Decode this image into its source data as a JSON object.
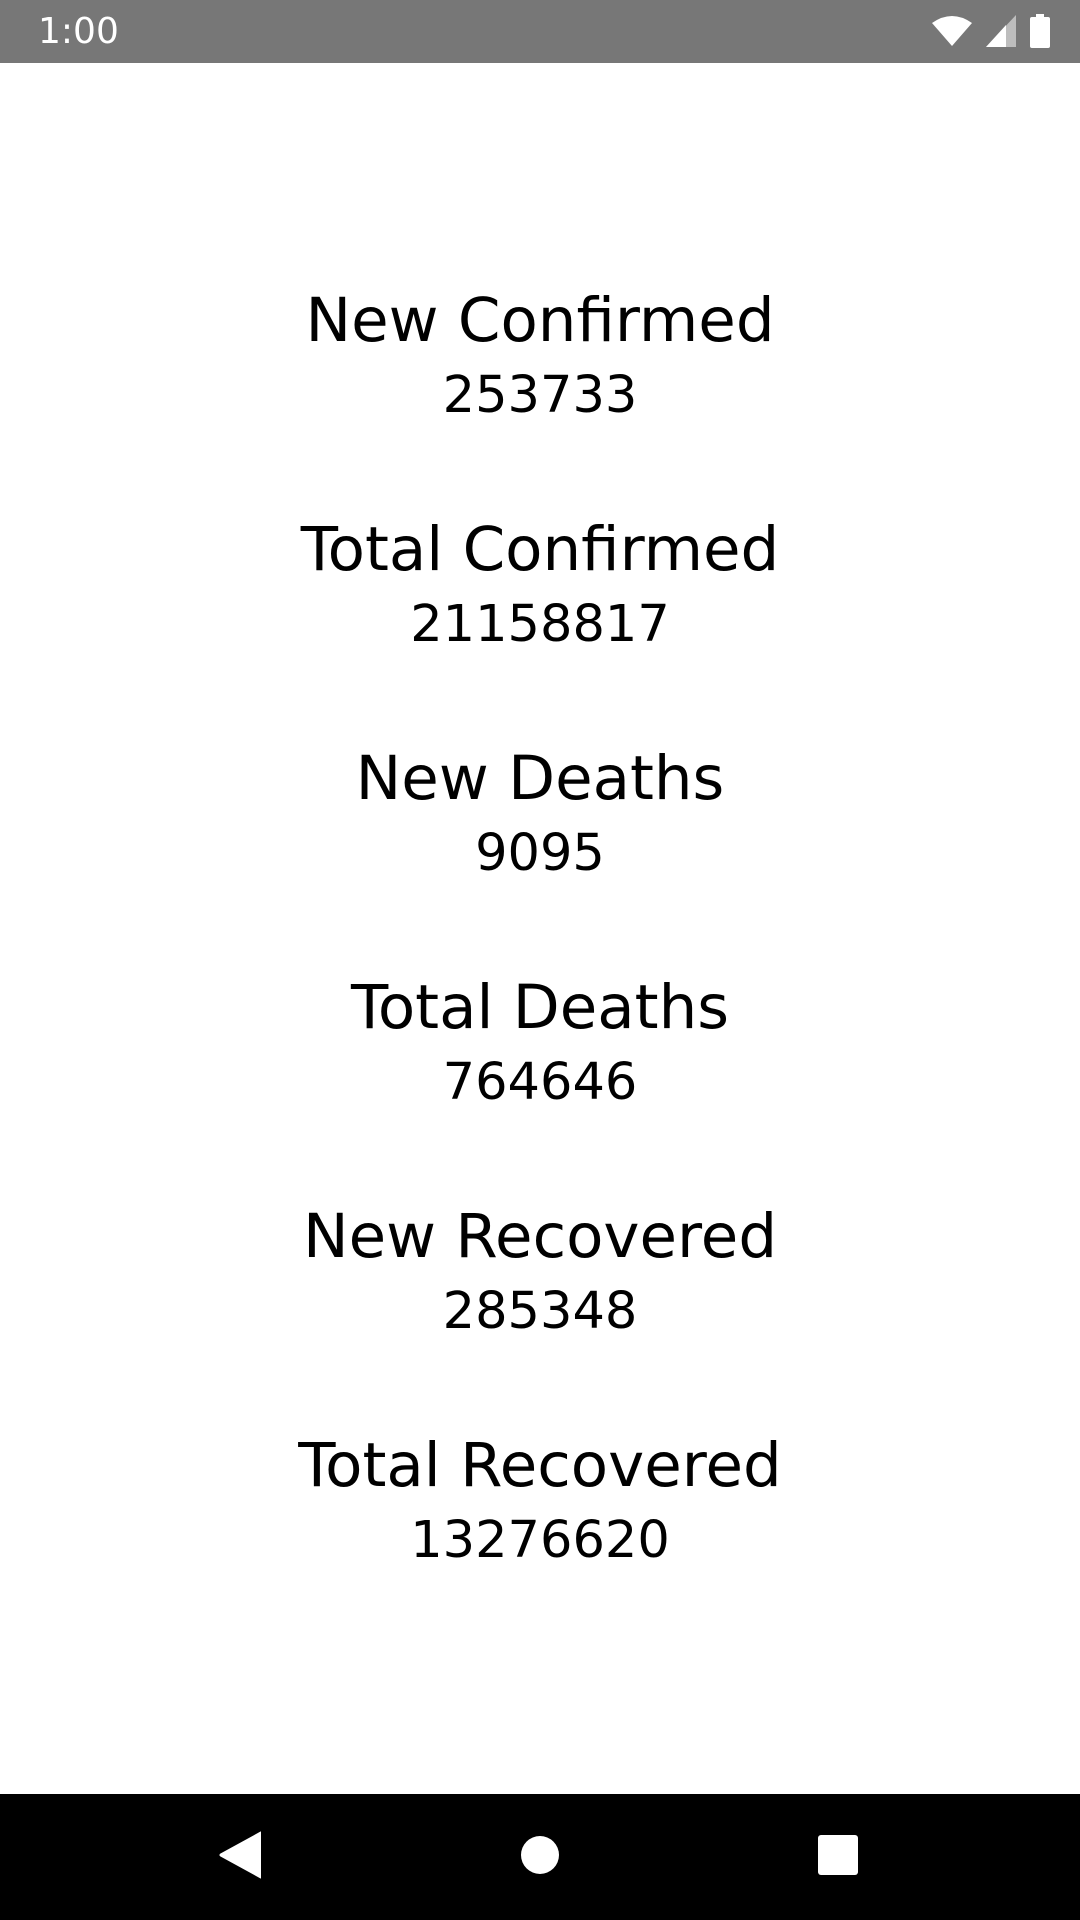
{
  "status_bar": {
    "time": "1:00",
    "icons": [
      "wifi-icon",
      "cell-signal-icon",
      "battery-icon"
    ]
  },
  "stats": [
    {
      "label": "New Confirmed",
      "value": "253733"
    },
    {
      "label": "Total Confirmed",
      "value": "21158817"
    },
    {
      "label": "New Deaths",
      "value": "9095"
    },
    {
      "label": "Total Deaths",
      "value": "764646"
    },
    {
      "label": "New Recovered",
      "value": "285348"
    },
    {
      "label": "Total Recovered",
      "value": "13276620"
    }
  ],
  "nav_bar": {
    "buttons": [
      "back-icon",
      "home-icon",
      "recents-icon"
    ]
  },
  "colors": {
    "status_bar_bg": "#777777",
    "nav_bar_bg": "#000000",
    "text": "#000000",
    "background": "#ffffff"
  }
}
